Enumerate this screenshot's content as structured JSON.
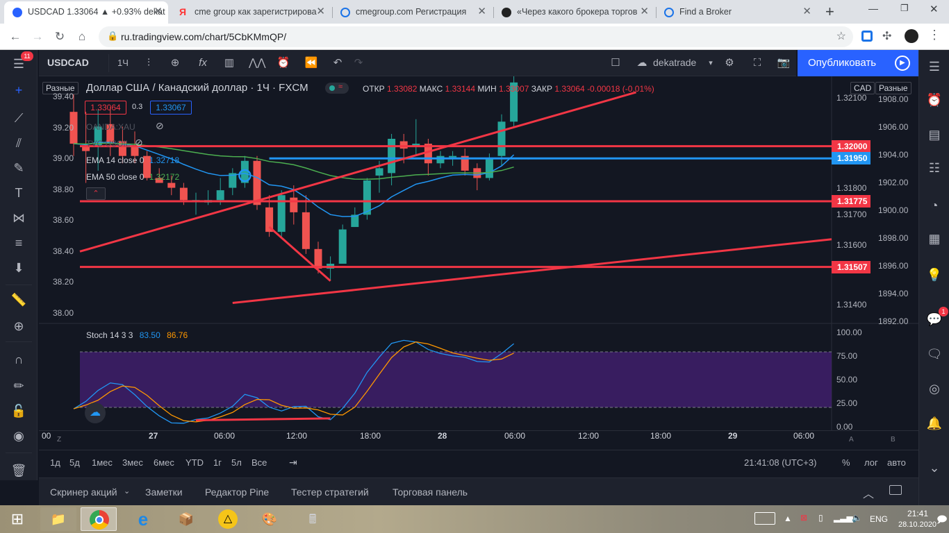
{
  "browser": {
    "tabs": [
      {
        "title": "USDCAD 1.33064 ▲ +0.93% dekat",
        "active": true,
        "icon": "tradingview-icon"
      },
      {
        "title": "cme group как зарегистрирова",
        "active": false,
        "icon": "yandex-icon"
      },
      {
        "title": "cmegroup.com Регистрация",
        "active": false,
        "icon": "globe-icon"
      },
      {
        "title": "«Через какого брокера торгов",
        "active": false,
        "icon": "video-icon"
      },
      {
        "title": "Find a Broker",
        "active": false,
        "icon": "globe-icon"
      }
    ],
    "url": "ru.tradingview.com/chart/5CbKMmQP/"
  },
  "toolbar": {
    "symbol": "USDCAD",
    "interval": "1Ч",
    "layout_name": "dekatrade",
    "publish_label": "Опубликовать",
    "notification_badge": "11"
  },
  "legend": {
    "title": "Доллар США / Канадский доллар · 1Ч · FXCM",
    "open_label": "ОТКР",
    "open": "1.33082",
    "high_label": "МАКС",
    "high": "1.33144",
    "low_label": "МИН",
    "low": "1.33007",
    "close_label": "ЗАКР",
    "close": "1.33064",
    "change": "-0.00018 (-0.01%)",
    "bid": "1.33064",
    "spread": "0.3",
    "ask": "1.33067",
    "oanda": "OANDA:XAU",
    "tvc": "TVC:USOIL",
    "ema14_label": "EMA 14 close 0",
    "ema14": "1.32718",
    "ema50_label": "EMA 50 close 0",
    "ema50": "1.32172",
    "scale_left": "Разные",
    "scale_right": "Разные",
    "currency": "CAD"
  },
  "left_axis": [
    "39.40",
    "39.20",
    "39.00",
    "38.80",
    "38.60",
    "38.40",
    "38.20",
    "38.00"
  ],
  "right_axis_outer": [
    "1908.00",
    "1906.00",
    "1904.00",
    "1902.00",
    "1900.00",
    "1898.00",
    "1896.00",
    "1894.00",
    "1892.00"
  ],
  "right_axis_inner": [
    "1.32100",
    "1.31900",
    "1.31800",
    "1.31700",
    "1.31600",
    "1.31400"
  ],
  "price_labels": [
    {
      "value": "1.32000",
      "color": "#f23645"
    },
    {
      "value": "1.31950",
      "color": "#2196f3"
    },
    {
      "value": "1.31775",
      "color": "#f23645"
    },
    {
      "value": "1.31507",
      "color": "#f23645"
    }
  ],
  "stoch": {
    "label": "Stoch 14 3 3",
    "k": "83.50",
    "d": "86.76",
    "axis": [
      "100.00",
      "75.00",
      "50.00",
      "25.00",
      "0.00"
    ]
  },
  "time_axis": [
    "00",
    "27",
    "06:00",
    "12:00",
    "18:00",
    "28",
    "06:00",
    "12:00",
    "18:00",
    "29",
    "06:00"
  ],
  "time_axis_corner_left": "Z",
  "time_axis_corner_a": "A",
  "time_axis_corner_b": "B",
  "ranges": [
    "1д",
    "5д",
    "1мес",
    "3мес",
    "6мес",
    "YTD",
    "1г",
    "5л",
    "Все"
  ],
  "clock": "21:41:08 (UTC+3)",
  "scale_options": {
    "percent": "%",
    "log": "лог",
    "auto": "авто"
  },
  "bottom_tabs": [
    "Скринер акций",
    "Заметки",
    "Редактор Pine",
    "Тестер стратегий",
    "Торговая панель"
  ],
  "taskbar": {
    "lang": "ENG",
    "time": "21:41",
    "date": "28.10.2020"
  },
  "chat_badge": "1",
  "colors": {
    "up": "#26a69a",
    "down": "#ef5350",
    "ema14": "#2196f3",
    "ema50": "#4caf50",
    "stoch_k": "#2196f3",
    "stoch_d": "#ff9800",
    "stoch_band": "#3f1e6b",
    "accent": "#2962ff"
  },
  "chart_data": {
    "type": "candlestick",
    "symbol": "USDCAD",
    "candles": [
      {
        "o": 1.3214,
        "h": 1.3222,
        "l": 1.3196,
        "c": 1.3201
      },
      {
        "o": 1.32,
        "h": 1.3214,
        "l": 1.3185,
        "c": 1.3198
      },
      {
        "o": 1.32,
        "h": 1.3215,
        "l": 1.319,
        "c": 1.3208
      },
      {
        "o": 1.3209,
        "h": 1.3216,
        "l": 1.3196,
        "c": 1.3201
      },
      {
        "o": 1.3202,
        "h": 1.3208,
        "l": 1.3193,
        "c": 1.3196
      },
      {
        "o": 1.32,
        "h": 1.3206,
        "l": 1.3193,
        "c": 1.3196
      },
      {
        "o": 1.3196,
        "h": 1.3198,
        "l": 1.3186,
        "c": 1.3187
      },
      {
        "o": 1.3187,
        "h": 1.3191,
        "l": 1.3186,
        "c": 1.3185
      },
      {
        "o": 1.3185,
        "h": 1.3188,
        "l": 1.318,
        "c": 1.3183
      },
      {
        "o": 1.3183,
        "h": 1.3185,
        "l": 1.3176,
        "c": 1.3178
      },
      {
        "o": 1.3178,
        "h": 1.3181,
        "l": 1.3172,
        "c": 1.3178
      },
      {
        "o": 1.3177,
        "h": 1.3182,
        "l": 1.3176,
        "c": 1.3178
      },
      {
        "o": 1.3178,
        "h": 1.3187,
        "l": 1.3176,
        "c": 1.3182
      },
      {
        "o": 1.3183,
        "h": 1.3191,
        "l": 1.318,
        "c": 1.3189
      },
      {
        "o": 1.3185,
        "h": 1.3196,
        "l": 1.3183,
        "c": 1.3194
      },
      {
        "o": 1.3194,
        "h": 1.3196,
        "l": 1.3174,
        "c": 1.3176
      },
      {
        "o": 1.3175,
        "h": 1.318,
        "l": 1.3163,
        "c": 1.3165
      },
      {
        "o": 1.3165,
        "h": 1.3182,
        "l": 1.3163,
        "c": 1.318
      },
      {
        "o": 1.3179,
        "h": 1.3184,
        "l": 1.3168,
        "c": 1.3173
      },
      {
        "o": 1.3173,
        "h": 1.318,
        "l": 1.3156,
        "c": 1.3158
      },
      {
        "o": 1.3158,
        "h": 1.3161,
        "l": 1.3148,
        "c": 1.315
      },
      {
        "o": 1.315,
        "h": 1.3155,
        "l": 1.3145,
        "c": 1.3152
      },
      {
        "o": 1.3152,
        "h": 1.3168,
        "l": 1.3152,
        "c": 1.3166
      },
      {
        "o": 1.3167,
        "h": 1.3175,
        "l": 1.3167,
        "c": 1.3172
      },
      {
        "o": 1.3172,
        "h": 1.3187,
        "l": 1.317,
        "c": 1.3186
      },
      {
        "o": 1.3188,
        "h": 1.3194,
        "l": 1.3181,
        "c": 1.3191
      },
      {
        "o": 1.3189,
        "h": 1.3205,
        "l": 1.3184,
        "c": 1.3203
      },
      {
        "o": 1.3202,
        "h": 1.3205,
        "l": 1.3193,
        "c": 1.3199
      },
      {
        "o": 1.32,
        "h": 1.3211,
        "l": 1.3196,
        "c": 1.3201
      },
      {
        "o": 1.3201,
        "h": 1.3203,
        "l": 1.3188,
        "c": 1.3193
      },
      {
        "o": 1.3193,
        "h": 1.3198,
        "l": 1.3191,
        "c": 1.3196
      },
      {
        "o": 1.3196,
        "h": 1.3198,
        "l": 1.3192,
        "c": 1.3196
      },
      {
        "o": 1.3196,
        "h": 1.3199,
        "l": 1.3188,
        "c": 1.319
      },
      {
        "o": 1.3191,
        "h": 1.3193,
        "l": 1.3182,
        "c": 1.3187
      },
      {
        "o": 1.3187,
        "h": 1.3197,
        "l": 1.3186,
        "c": 1.3195
      },
      {
        "o": 1.3196,
        "h": 1.3213,
        "l": 1.3192,
        "c": 1.321
      },
      {
        "o": 1.321,
        "h": 1.3229,
        "l": 1.3208,
        "c": 1.3226
      }
    ]
  }
}
